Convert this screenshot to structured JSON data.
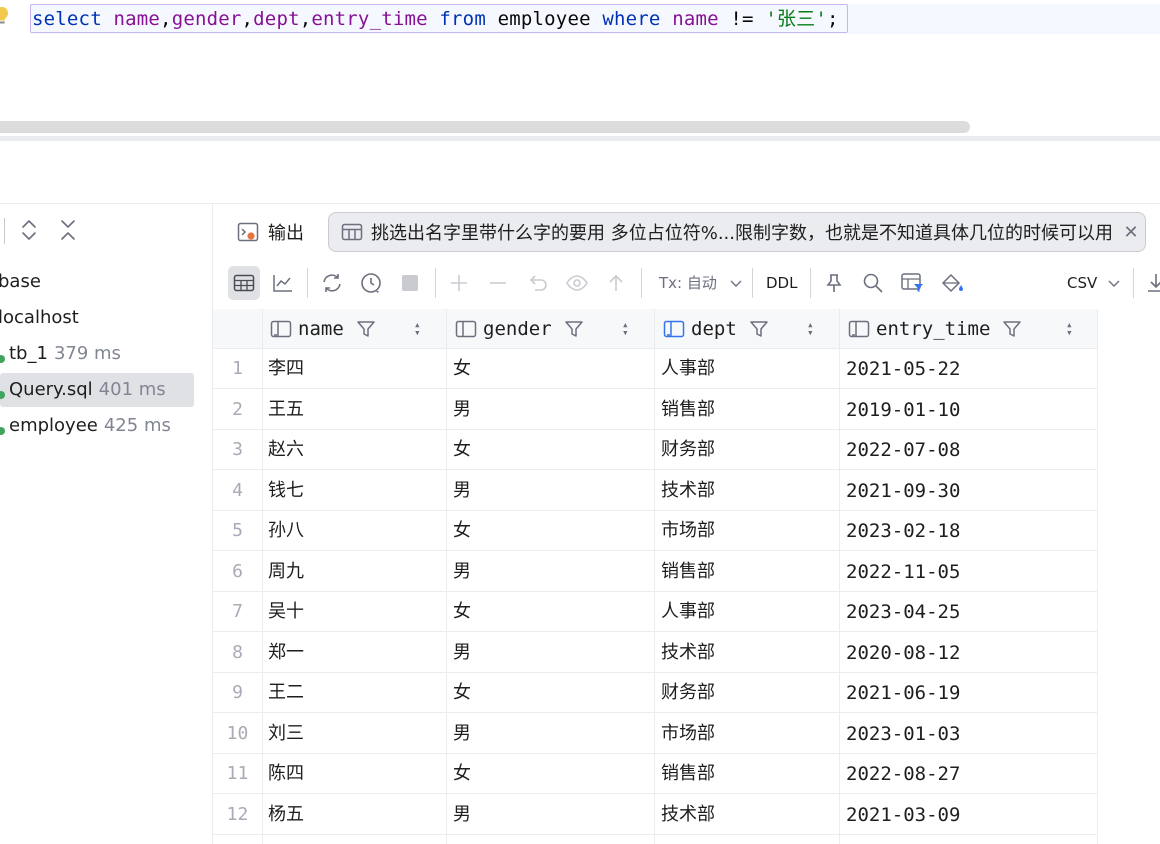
{
  "editor": {
    "sql_parts": [
      {
        "t": "select",
        "c": "kw"
      },
      {
        "t": " ",
        "c": "pl"
      },
      {
        "t": "name",
        "c": "id"
      },
      {
        "t": ",",
        "c": "pl"
      },
      {
        "t": "gender",
        "c": "id"
      },
      {
        "t": ",",
        "c": "pl"
      },
      {
        "t": "dept",
        "c": "id"
      },
      {
        "t": ",",
        "c": "pl"
      },
      {
        "t": "entry_time",
        "c": "id"
      },
      {
        "t": " ",
        "c": "pl"
      },
      {
        "t": "from",
        "c": "kw"
      },
      {
        "t": " employee ",
        "c": "pl"
      },
      {
        "t": "where",
        "c": "kw"
      },
      {
        "t": " ",
        "c": "pl"
      },
      {
        "t": "name",
        "c": "id"
      },
      {
        "t": " != ",
        "c": "pl"
      },
      {
        "t": "'张三'",
        "c": "str"
      },
      {
        "t": ";",
        "c": "pl"
      }
    ]
  },
  "services": {
    "items": [
      {
        "label": "base",
        "time": ""
      },
      {
        "label": "localhost",
        "time": ""
      },
      {
        "label": "tb_1",
        "time": "379 ms"
      },
      {
        "label": "Query.sql",
        "time": "401 ms"
      },
      {
        "label": "employee",
        "time": "425 ms"
      }
    ]
  },
  "tabs": {
    "output_label": "输出",
    "active_label": "挑选出名字里带什么字的要用 多位占位符%...限制字数，也就是不知道具体几位的时候可以用"
  },
  "toolbar": {
    "tx_label": "Tx: 自动",
    "ddl_label": "DDL",
    "export_label": "CSV"
  },
  "grid": {
    "columns": [
      "name",
      "gender",
      "dept",
      "entry_time"
    ],
    "rows": [
      [
        "1",
        "李四",
        "女",
        "人事部",
        "2021-05-22"
      ],
      [
        "2",
        "王五",
        "男",
        "销售部",
        "2019-01-10"
      ],
      [
        "3",
        "赵六",
        "女",
        "财务部",
        "2022-07-08"
      ],
      [
        "4",
        "钱七",
        "男",
        "技术部",
        "2021-09-30"
      ],
      [
        "5",
        "孙八",
        "女",
        "市场部",
        "2023-02-18"
      ],
      [
        "6",
        "周九",
        "男",
        "销售部",
        "2022-11-05"
      ],
      [
        "7",
        "吴十",
        "女",
        "人事部",
        "2023-04-25"
      ],
      [
        "8",
        "郑一",
        "男",
        "技术部",
        "2020-08-12"
      ],
      [
        "9",
        "王二",
        "女",
        "财务部",
        "2021-06-19"
      ],
      [
        "10",
        "刘三",
        "男",
        "市场部",
        "2023-01-03"
      ],
      [
        "11",
        "陈四",
        "女",
        "销售部",
        "2022-08-27"
      ],
      [
        "12",
        "杨五",
        "男",
        "技术部",
        "2021-03-09"
      ]
    ]
  }
}
